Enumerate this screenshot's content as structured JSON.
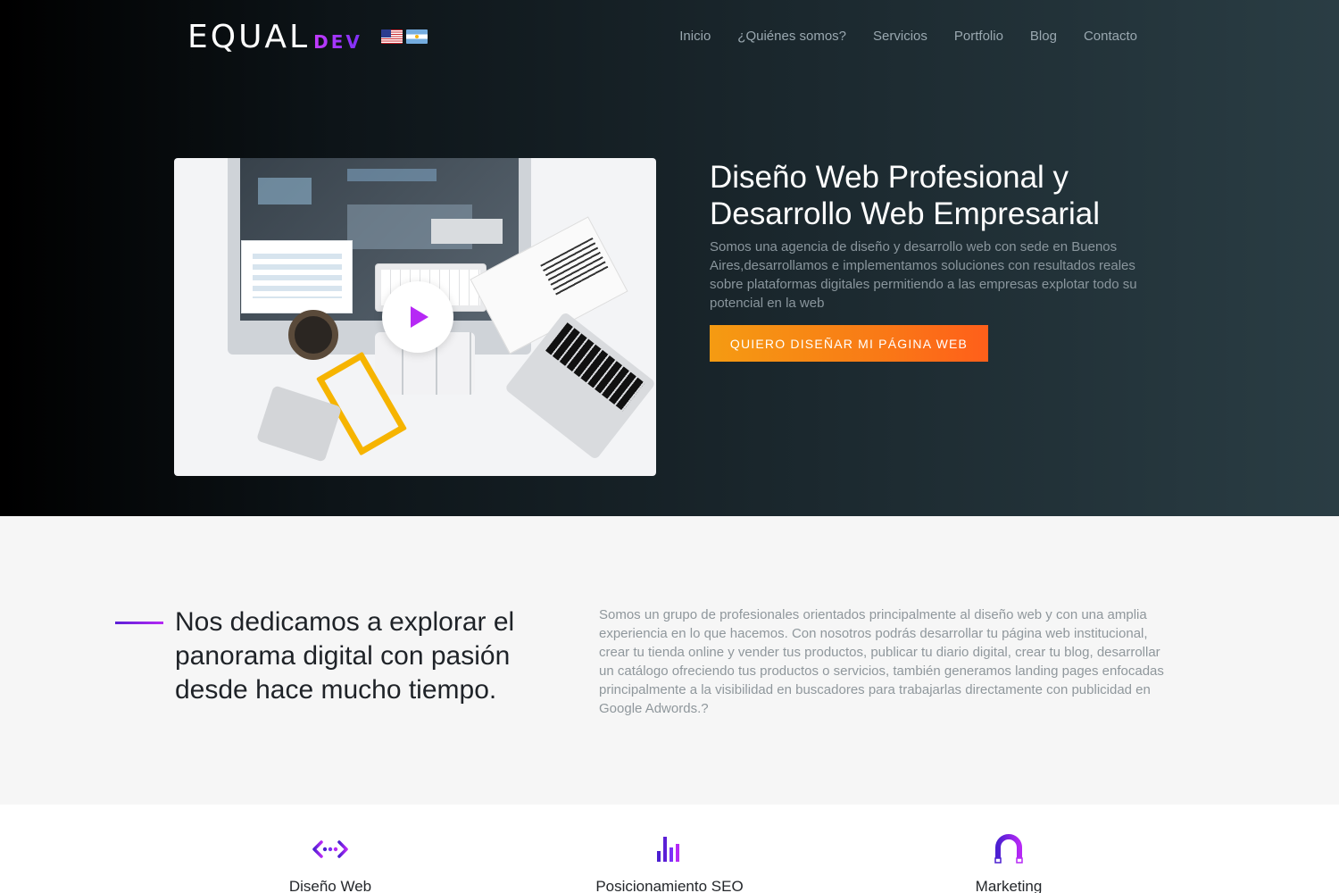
{
  "brand": {
    "logo_main": "EQUAL",
    "logo_sub": "DEV",
    "accent_purple": "#b628f5",
    "accent_orange": "#f97a16"
  },
  "languages": [
    {
      "name": "English",
      "icon": "us-flag-icon"
    },
    {
      "name": "Español",
      "icon": "argentina-flag-icon"
    }
  ],
  "nav": {
    "items": [
      "Inicio",
      "¿Quiénes somos?",
      "Servicios",
      "Portfolio",
      "Blog",
      "Contacto"
    ]
  },
  "hero": {
    "title": "Diseño Web Profesional y Desarrollo Web Empresarial",
    "description": "Somos una agencia de diseño y desarrollo web con sede en Buenos Aires,desarrollamos e implementamos soluciones con resultados reales sobre plataformas digitales permitiendo a las empresas explotar todo su potencial en la web",
    "cta_label": "QUIERO DISEÑAR MI PÁGINA WEB",
    "video_icon": "play-icon"
  },
  "about": {
    "title": "Nos dedicamos a explorar el panorama digital con pasión desde hace mucho tiempo.",
    "text": "Somos un grupo de profesionales orientados principalmente al diseño web y con una amplia experiencia en lo que hacemos. Con nosotros podrás desarrollar tu página web institucional, crear tu tienda online y vender tus productos, publicar tu diario digital, crear tu blog, desarrollar un catálogo ofreciendo tus productos o servicios, también generamos landing pages enfocadas principalmente a la visibilidad en buscadores para trabajarlas directamente con publicidad en Google Adwords.?"
  },
  "services": [
    {
      "title": "Diseño Web",
      "icon": "code-icon"
    },
    {
      "title": "Posicionamiento SEO",
      "icon": "bar-chart-icon"
    },
    {
      "title": "Marketing",
      "icon": "magnet-icon"
    }
  ]
}
